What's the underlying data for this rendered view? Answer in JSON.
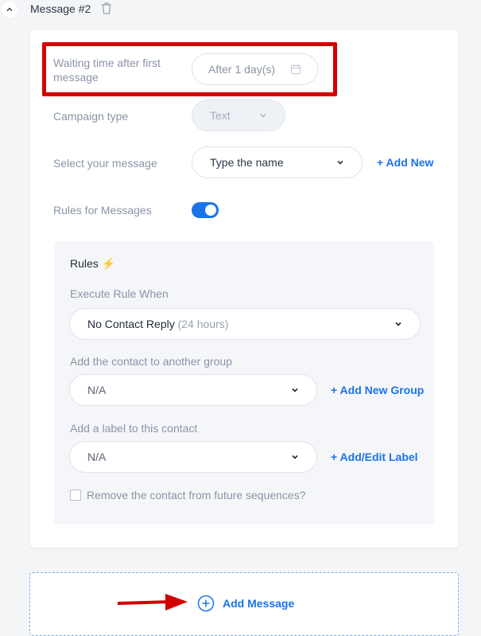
{
  "header": {
    "title": "Message #2"
  },
  "form": {
    "waiting_label": "Waiting time after first message",
    "waiting_value": "After 1 day(s)",
    "campaign_label": "Campaign type",
    "campaign_value": "Text",
    "message_label": "Select your message",
    "message_placeholder": "Type the name",
    "add_new": "+ Add New",
    "rules_label": "Rules for Messages",
    "rules_enabled": true
  },
  "rules": {
    "title": "Rules",
    "title_emoji": "⚡",
    "execute_label": "Execute Rule When",
    "execute_value": "No Contact Reply",
    "execute_suffix": "(24 hours)",
    "group_label": "Add the contact to another group",
    "group_value": "N/A",
    "add_group": "+ Add New Group",
    "label_label": "Add a label to this contact",
    "label_value": "N/A",
    "add_label": "+ Add/Edit Label",
    "remove_label": "Remove the contact from future sequences?",
    "remove_checked": false
  },
  "footer": {
    "add_message": "Add Message"
  },
  "colors": {
    "accent": "#1a73e8",
    "highlight": "#d40000"
  }
}
